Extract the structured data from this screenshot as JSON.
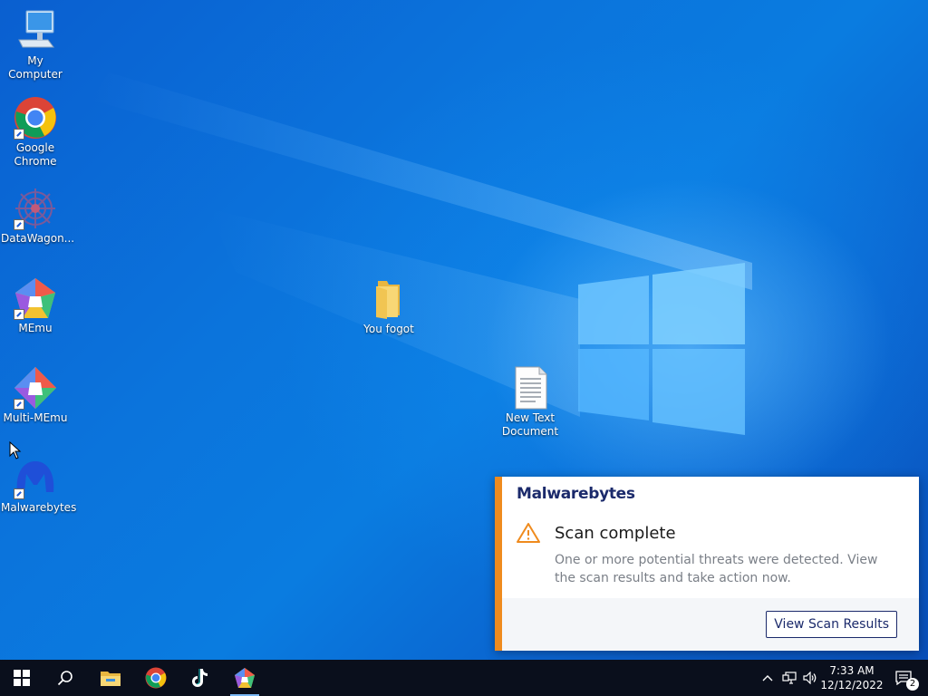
{
  "desktop": {
    "icons": [
      {
        "label": "My Computer",
        "icon": "computer-icon"
      },
      {
        "label": "Google\nChrome",
        "icon": "chrome-icon"
      },
      {
        "label": "DataWagon...",
        "icon": "datawagon-icon"
      },
      {
        "label": "MEmu",
        "icon": "memu-icon"
      },
      {
        "label": "Multi-MEmu",
        "icon": "multi-memu-icon"
      },
      {
        "label": "Malwarebytes",
        "icon": "malwarebytes-icon"
      },
      {
        "label": "You fogot",
        "icon": "folder-icon"
      },
      {
        "label": "New Text\nDocument",
        "icon": "text-document-icon"
      }
    ]
  },
  "notification": {
    "brand": "Malwarebytes",
    "title": "Scan complete",
    "message": "One or more potential threats were detected. View the scan results and take action now.",
    "button_label": "View Scan Results",
    "accent_color": "#ef8b1e",
    "brand_color": "#1b2a6b"
  },
  "taskbar": {
    "pinned": [
      "start-icon",
      "search-icon",
      "file-explorer-icon",
      "chrome-icon",
      "tiktok-icon",
      "memu-icon"
    ],
    "clock_time": "7:33 AM",
    "clock_date": "12/12/2022",
    "notification_count": "2"
  }
}
